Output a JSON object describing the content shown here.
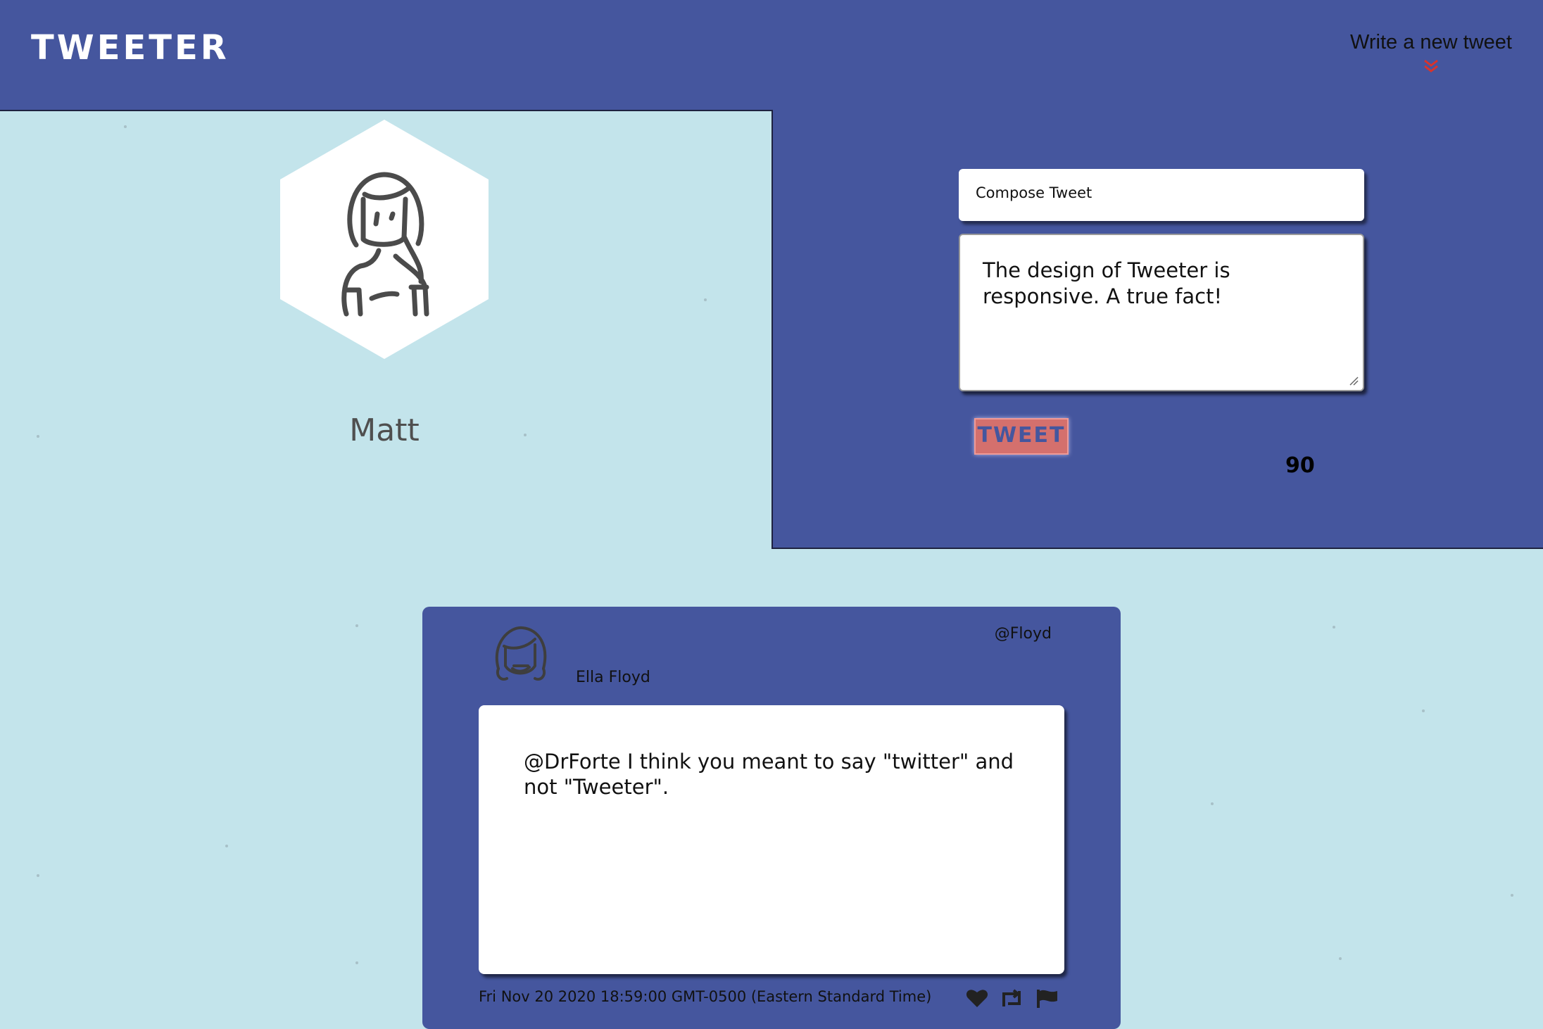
{
  "nav": {
    "brand": "TWEETER",
    "write_link": "Write a new tweet",
    "chevron_color": "#d9332b"
  },
  "profile": {
    "username": "Matt"
  },
  "compose": {
    "title": "Compose Tweet",
    "text": "The design of Tweeter is responsive. A true fact!",
    "button_label": "TWEET",
    "char_counter": "90"
  },
  "tweet": {
    "name": "Ella Floyd",
    "handle": "@Floyd",
    "content": "@DrForte I think you meant to say \"twitter\" and not \"Tweeter\".",
    "date": "Fri Nov 20 2020 18:59:00 GMT-0500 (Eastern Standard Time)"
  },
  "colors": {
    "background": "#c3e4eb",
    "panel": "#45569e",
    "button": "#d4706d"
  }
}
